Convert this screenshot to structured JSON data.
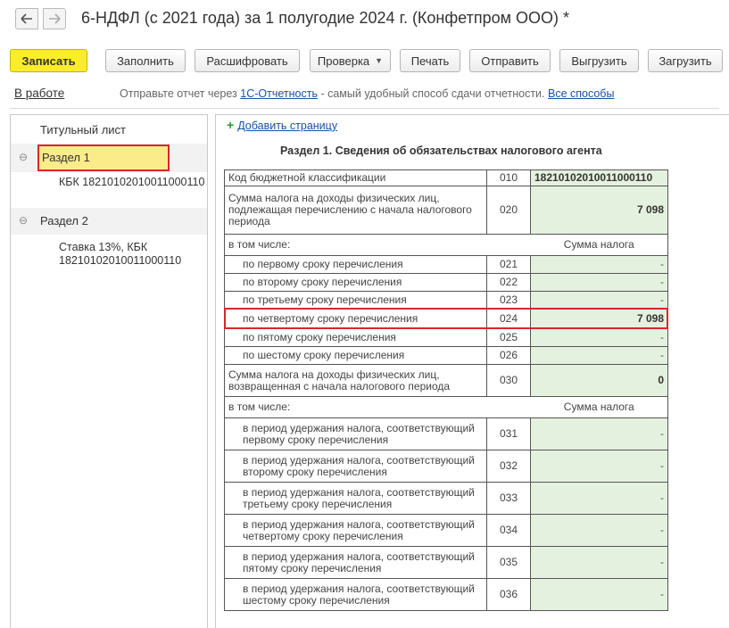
{
  "window": {
    "title": "6-НДФЛ (с 2021 года) за 1 полугодие 2024 г. (Конфетпром ООО) *"
  },
  "toolbar": {
    "save": "Записать",
    "fill": "Заполнить",
    "decode": "Расшифровать",
    "check": "Проверка",
    "print": "Печать",
    "send": "Отправить",
    "export": "Выгрузить",
    "import": "Загрузить"
  },
  "status": {
    "state": "В работе",
    "msg_prefix": "Отправьте отчет через ",
    "msg_link": "1С-Отчетность",
    "msg_middle": " - самый удобный способ сдачи отчетности. ",
    "msg_all": "Все способы"
  },
  "tree": {
    "title_page": "Титульный лист",
    "section1": "Раздел 1",
    "section1_sub": "КБК 18210102010011000110",
    "section2": "Раздел 2",
    "section2_sub_line1": "Ставка 13%, КБК",
    "section2_sub_line2": "18210102010011000110",
    "toggle": "⊖"
  },
  "form": {
    "add_page": "Добавить страницу",
    "add_plus": "+",
    "heading": "Раздел 1. Сведения об обязательствах налогового агента",
    "rows": [
      {
        "label": "Код бюджетной классификации",
        "code": "010",
        "value": "18210102010011000110"
      },
      {
        "label": "Сумма налога на доходы физических лиц, подлежащая перечислению с начала налогового периода",
        "code": "020",
        "value": "7 098"
      },
      {
        "label": "в том числе:",
        "code": "",
        "value": "Сумма налога"
      },
      {
        "label": "по первому сроку перечисления",
        "code": "021",
        "value": "-"
      },
      {
        "label": "по второму сроку перечисления",
        "code": "022",
        "value": "-"
      },
      {
        "label": "по третьему сроку перечисления",
        "code": "023",
        "value": "-"
      },
      {
        "label": "по четвертому сроку перечисления",
        "code": "024",
        "value": "7 098"
      },
      {
        "label": "по пятому сроку перечисления",
        "code": "025",
        "value": "-"
      },
      {
        "label": "по шестому сроку перечисления",
        "code": "026",
        "value": "-"
      },
      {
        "label": "Сумма налога на доходы физических лиц, возвращенная с начала налогового периода",
        "code": "030",
        "value": "0"
      },
      {
        "label": "в том числе:",
        "code": "",
        "value": "Сумма налога"
      },
      {
        "label": "в период удержания налога, соответствующий первому сроку перечисления",
        "code": "031",
        "value": "-"
      },
      {
        "label": "в период удержания налога, соответствующий второму сроку перечисления",
        "code": "032",
        "value": "-"
      },
      {
        "label": "в период удержания налога, соответствующий третьему сроку перечисления",
        "code": "033",
        "value": "-"
      },
      {
        "label": "в период удержания налога, соответствующий четвертому сроку перечисления",
        "code": "034",
        "value": "-"
      },
      {
        "label": "в период удержания налога, соответствующий пятому сроку перечисления",
        "code": "035",
        "value": "-"
      },
      {
        "label": "в период удержания налога, соответствующий шестому сроку перечисления",
        "code": "036",
        "value": "-"
      }
    ]
  },
  "colors": {
    "highlight": "#d9262c",
    "primary_button": "#fbec2e",
    "cell_fill": "#e5f1df",
    "link": "#1a4fa8"
  }
}
